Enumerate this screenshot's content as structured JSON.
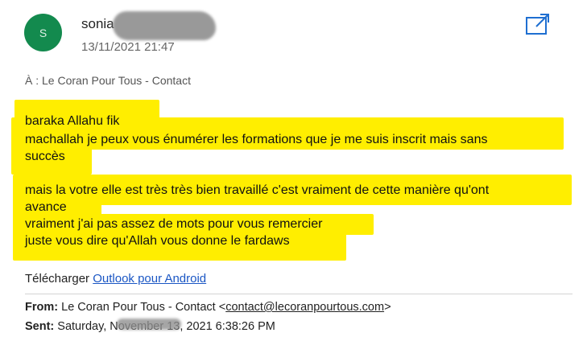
{
  "header": {
    "avatar_letter": "S",
    "sender_name": "sonia",
    "date": "13/11/2021 21:47"
  },
  "recipient": {
    "label": "À :",
    "value": "Le Coran Pour Tous - Contact"
  },
  "message": {
    "lines": [
      "baraka Allahu fik",
      "machallah je peux vous énumérer les formations que  je me suis inscrit mais sans",
      "succès",
      "mais la votre elle est très très bien travaillé c'est vraiment de cette manière qu'ont",
      "avance",
      "vraiment j'ai pas assez de mots pour vous remercier",
      "juste vous dire qu'Allah vous donne le fardaws"
    ]
  },
  "footer": {
    "download_prefix": "Télécharger",
    "download_link": "Outlook pour Android"
  },
  "quoted": {
    "from_label": "From:",
    "from_name": "Le Coran Pour Tous - Contact <",
    "from_email": "contact@lecoranpourtous.com",
    "from_suffix": ">",
    "sent_label": "Sent:",
    "sent_value": "Saturday, November 13, 2021 6:38:26 PM"
  },
  "colors": {
    "highlight": "#ffee00",
    "avatar": "#138a4e",
    "link": "#1a56c4",
    "accent_icon": "#1f6fd1"
  }
}
